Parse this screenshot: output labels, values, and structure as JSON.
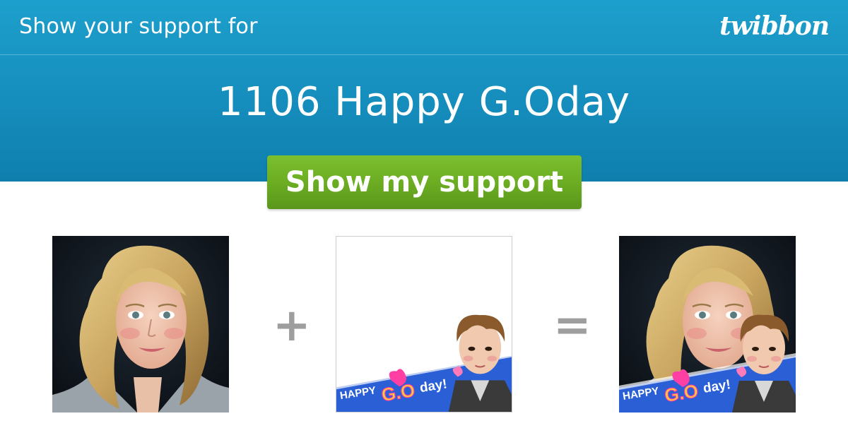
{
  "header": {
    "tagline": "Show your support for",
    "logo": "twibbon",
    "title": "1106 Happy G.Oday"
  },
  "cta": {
    "label": "Show my support"
  },
  "preview": {
    "plus_symbol": "+",
    "equals_symbol": "=",
    "frame_banner_text": {
      "happy": "HAPPY",
      "go": "G.O",
      "day": "day!"
    }
  },
  "colors": {
    "header_top": "#1d9fcc",
    "header_bottom": "#0f7fae",
    "cta_green": "#6aab22",
    "banner_blue": "#2a5fd6",
    "operator_gray": "#9e9e9e"
  }
}
